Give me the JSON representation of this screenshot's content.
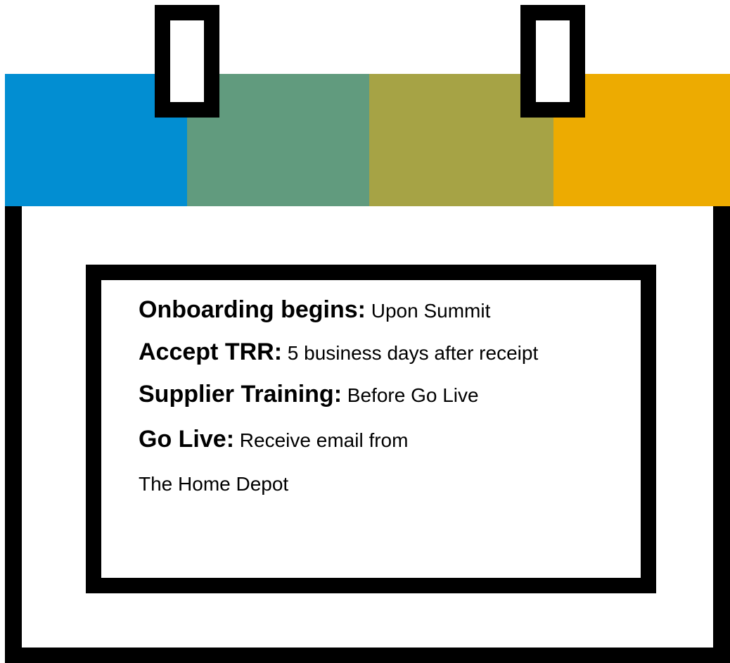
{
  "calendar": {
    "band_colors": [
      "#028ed2",
      "#619b7e",
      "#a6a345",
      "#edab01"
    ],
    "items": [
      {
        "label": "Onboarding begins:",
        "value": " Upon Summit"
      },
      {
        "label": "Accept TRR:",
        "value": " 5 business days after receipt"
      },
      {
        "label": "Supplier Training:",
        "value": " Before Go Live"
      },
      {
        "label": "Go Live:",
        "value": " Receive email from"
      },
      {
        "label": "",
        "value": "The Home Depot"
      }
    ]
  }
}
